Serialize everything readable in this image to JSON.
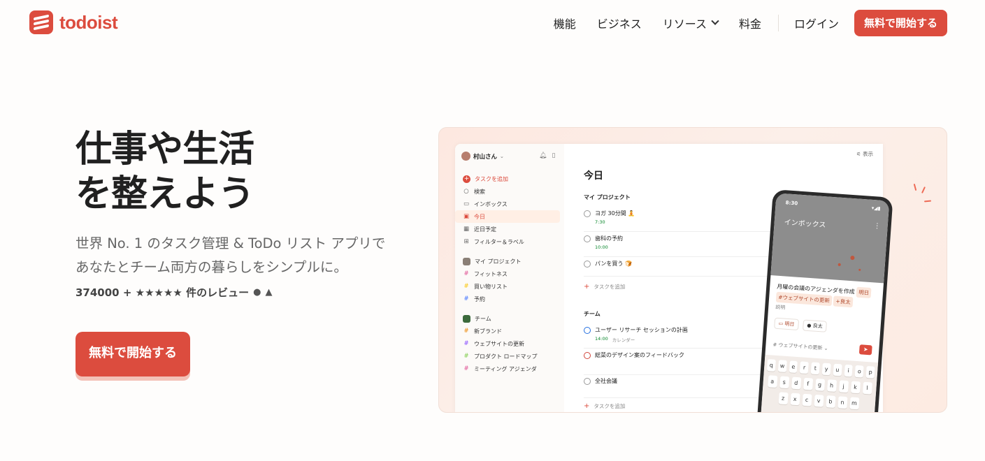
{
  "brand": {
    "name": "todoist",
    "color": "#dc4c3e"
  },
  "nav": {
    "items": [
      "機能",
      "ビジネス",
      "リソース",
      "料金"
    ],
    "login": "ログイン",
    "cta": "無料で開始する"
  },
  "hero": {
    "title_line1": "仕事や生活",
    "title_line2": "を整えよう",
    "sub_line1": "世界 No. 1 のタスク管理 & ToDo リスト アプリで",
    "sub_line2": "あなたとチーム両方の暮らしをシンプルに。",
    "reviews": "374000 + ★★★★★ 件のレビュー",
    "cta": "無料で開始する"
  },
  "app": {
    "user": "村山さん",
    "view": "表示",
    "sidebar": {
      "add_task": "タスクを追加",
      "search": "検索",
      "inbox": "インボックス",
      "today": "今日",
      "upcoming": "近日予定",
      "filters": "フィルター＆ラベル",
      "my_projects": "マイ プロジェクト",
      "projects": [
        "フィットネス",
        "買い物リスト",
        "予約"
      ],
      "team": "チーム",
      "team_projects": [
        "新ブランド",
        "ウェブサイトの更新",
        "プロダクト ロードマップ",
        "ミーティング アジェンダ"
      ]
    },
    "main": {
      "title": "今日",
      "section1": "マイ プロジェクト",
      "tasks1": [
        {
          "name": "ヨガ 30分間 🧘",
          "meta": "7:30"
        },
        {
          "name": "歯科の予約",
          "meta": "10:00"
        },
        {
          "name": "パンを買う 🍞",
          "meta": ""
        }
      ],
      "add_task": "タスクを追加",
      "section2": "チーム",
      "tasks2": [
        {
          "name": "ユーザー リサーチ セッションの計画",
          "meta": "14:00",
          "meta2": "カレンダー"
        },
        {
          "name": "総菜のデザイン案のフィードバック",
          "meta": ""
        },
        {
          "name": "全社会議",
          "meta": ""
        }
      ]
    },
    "phone": {
      "time": "8:30",
      "title": "インボックス",
      "task_text": "月曜の会議のアジェンダを作成",
      "tag_date": "明日",
      "tag_project": "#ウェブサイトの更新",
      "tag_user": "+良太",
      "desc": "説明",
      "chip_date": "明日",
      "chip_user": "良太",
      "project": "ウェブサイトの更新",
      "kb_row1": [
        "q",
        "w",
        "e",
        "r",
        "t",
        "y",
        "u",
        "i",
        "o",
        "p"
      ],
      "kb_row2": [
        "a",
        "s",
        "d",
        "f",
        "g",
        "h",
        "j",
        "k",
        "l"
      ],
      "kb_row3": [
        "z",
        "x",
        "c",
        "v",
        "b",
        "n",
        "m"
      ]
    }
  }
}
